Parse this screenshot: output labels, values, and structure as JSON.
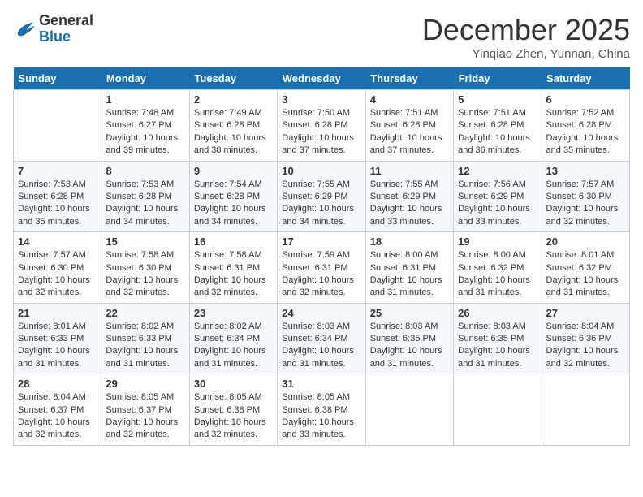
{
  "header": {
    "logo_general": "General",
    "logo_blue": "Blue",
    "month_title": "December 2025",
    "location": "Yinqiao Zhen, Yunnan, China"
  },
  "days_of_week": [
    "Sunday",
    "Monday",
    "Tuesday",
    "Wednesday",
    "Thursday",
    "Friday",
    "Saturday"
  ],
  "weeks": [
    [
      {
        "day": "",
        "sunrise": "",
        "sunset": "",
        "daylight": ""
      },
      {
        "day": "1",
        "sunrise": "7:48 AM",
        "sunset": "6:27 PM",
        "daylight": "10 hours and 39 minutes."
      },
      {
        "day": "2",
        "sunrise": "7:49 AM",
        "sunset": "6:28 PM",
        "daylight": "10 hours and 38 minutes."
      },
      {
        "day": "3",
        "sunrise": "7:50 AM",
        "sunset": "6:28 PM",
        "daylight": "10 hours and 37 minutes."
      },
      {
        "day": "4",
        "sunrise": "7:51 AM",
        "sunset": "6:28 PM",
        "daylight": "10 hours and 37 minutes."
      },
      {
        "day": "5",
        "sunrise": "7:51 AM",
        "sunset": "6:28 PM",
        "daylight": "10 hours and 36 minutes."
      },
      {
        "day": "6",
        "sunrise": "7:52 AM",
        "sunset": "6:28 PM",
        "daylight": "10 hours and 35 minutes."
      }
    ],
    [
      {
        "day": "7",
        "sunrise": "7:53 AM",
        "sunset": "6:28 PM",
        "daylight": "10 hours and 35 minutes."
      },
      {
        "day": "8",
        "sunrise": "7:53 AM",
        "sunset": "6:28 PM",
        "daylight": "10 hours and 34 minutes."
      },
      {
        "day": "9",
        "sunrise": "7:54 AM",
        "sunset": "6:28 PM",
        "daylight": "10 hours and 34 minutes."
      },
      {
        "day": "10",
        "sunrise": "7:55 AM",
        "sunset": "6:29 PM",
        "daylight": "10 hours and 34 minutes."
      },
      {
        "day": "11",
        "sunrise": "7:55 AM",
        "sunset": "6:29 PM",
        "daylight": "10 hours and 33 minutes."
      },
      {
        "day": "12",
        "sunrise": "7:56 AM",
        "sunset": "6:29 PM",
        "daylight": "10 hours and 33 minutes."
      },
      {
        "day": "13",
        "sunrise": "7:57 AM",
        "sunset": "6:30 PM",
        "daylight": "10 hours and 32 minutes."
      }
    ],
    [
      {
        "day": "14",
        "sunrise": "7:57 AM",
        "sunset": "6:30 PM",
        "daylight": "10 hours and 32 minutes."
      },
      {
        "day": "15",
        "sunrise": "7:58 AM",
        "sunset": "6:30 PM",
        "daylight": "10 hours and 32 minutes."
      },
      {
        "day": "16",
        "sunrise": "7:58 AM",
        "sunset": "6:31 PM",
        "daylight": "10 hours and 32 minutes."
      },
      {
        "day": "17",
        "sunrise": "7:59 AM",
        "sunset": "6:31 PM",
        "daylight": "10 hours and 32 minutes."
      },
      {
        "day": "18",
        "sunrise": "8:00 AM",
        "sunset": "6:31 PM",
        "daylight": "10 hours and 31 minutes."
      },
      {
        "day": "19",
        "sunrise": "8:00 AM",
        "sunset": "6:32 PM",
        "daylight": "10 hours and 31 minutes."
      },
      {
        "day": "20",
        "sunrise": "8:01 AM",
        "sunset": "6:32 PM",
        "daylight": "10 hours and 31 minutes."
      }
    ],
    [
      {
        "day": "21",
        "sunrise": "8:01 AM",
        "sunset": "6:33 PM",
        "daylight": "10 hours and 31 minutes."
      },
      {
        "day": "22",
        "sunrise": "8:02 AM",
        "sunset": "6:33 PM",
        "daylight": "10 hours and 31 minutes."
      },
      {
        "day": "23",
        "sunrise": "8:02 AM",
        "sunset": "6:34 PM",
        "daylight": "10 hours and 31 minutes."
      },
      {
        "day": "24",
        "sunrise": "8:03 AM",
        "sunset": "6:34 PM",
        "daylight": "10 hours and 31 minutes."
      },
      {
        "day": "25",
        "sunrise": "8:03 AM",
        "sunset": "6:35 PM",
        "daylight": "10 hours and 31 minutes."
      },
      {
        "day": "26",
        "sunrise": "8:03 AM",
        "sunset": "6:35 PM",
        "daylight": "10 hours and 31 minutes."
      },
      {
        "day": "27",
        "sunrise": "8:04 AM",
        "sunset": "6:36 PM",
        "daylight": "10 hours and 32 minutes."
      }
    ],
    [
      {
        "day": "28",
        "sunrise": "8:04 AM",
        "sunset": "6:37 PM",
        "daylight": "10 hours and 32 minutes."
      },
      {
        "day": "29",
        "sunrise": "8:05 AM",
        "sunset": "6:37 PM",
        "daylight": "10 hours and 32 minutes."
      },
      {
        "day": "30",
        "sunrise": "8:05 AM",
        "sunset": "6:38 PM",
        "daylight": "10 hours and 32 minutes."
      },
      {
        "day": "31",
        "sunrise": "8:05 AM",
        "sunset": "6:38 PM",
        "daylight": "10 hours and 33 minutes."
      },
      {
        "day": "",
        "sunrise": "",
        "sunset": "",
        "daylight": ""
      },
      {
        "day": "",
        "sunrise": "",
        "sunset": "",
        "daylight": ""
      },
      {
        "day": "",
        "sunrise": "",
        "sunset": "",
        "daylight": ""
      }
    ]
  ]
}
